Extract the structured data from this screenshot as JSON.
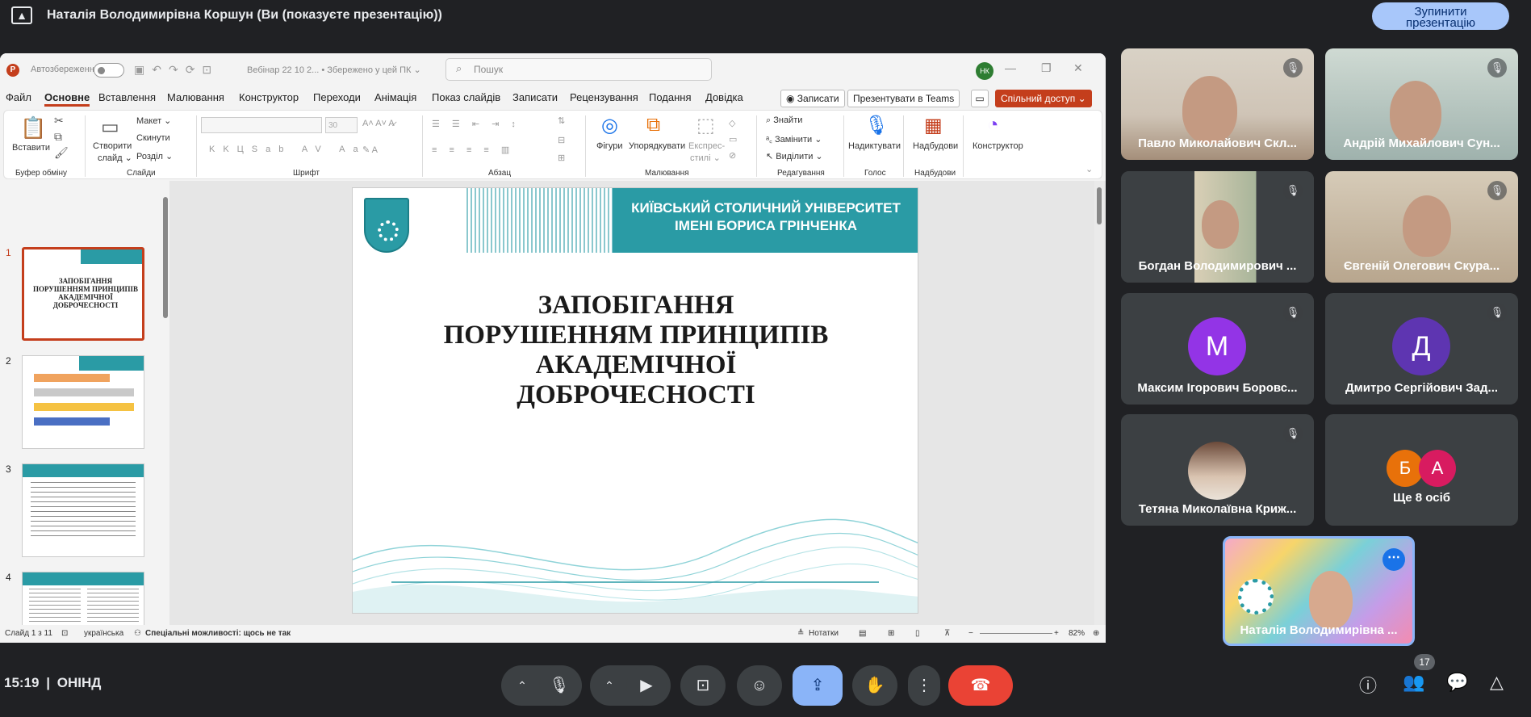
{
  "top": {
    "title": "Наталія Володимирівна Коршун (Ви (показуєте презентацію))",
    "stop_line1": "Зупинити",
    "stop_line2": "презентацію"
  },
  "ppt": {
    "autosave": "Автозбереження",
    "doc_name": "Вебінар 22 10 2...  •  Збережено у цей ПК ⌄",
    "search_placeholder": "Пошук",
    "user_initials": "НК",
    "menu": [
      "Файл",
      "Основне",
      "Вставлення",
      "Малювання",
      "Конструктор",
      "Переходи",
      "Анімація",
      "Показ слайдів",
      "Записати",
      "Рецензування",
      "Подання",
      "Довідка"
    ],
    "record_btn": "◉ Записати",
    "teams_btn": "Презентувати в Teams",
    "share_btn": "Спільний доступ ⌄",
    "ribbon": {
      "paste": "Вставити",
      "clipboard": "Буфер обміну",
      "new_slide_1": "Створити",
      "new_slide_2": "слайд ⌄",
      "layout": "Макет ⌄",
      "reset": "Скинути",
      "section": "Розділ ⌄",
      "slides": "Слайди",
      "font_size": "30",
      "font": "Шрифт",
      "paragraph": "Абзац",
      "shapes": "Фігури",
      "arrange": "Упорядкувати",
      "quick_styles_1": "Експрес-",
      "quick_styles_2": "стилі ⌄",
      "drawing": "Малювання",
      "find": "Знайти",
      "replace": "Замінити ⌄",
      "select": "Виділити ⌄",
      "editing": "Редагування",
      "dictate": "Надиктувати",
      "voice": "Голос",
      "addins_btn": "Надбудови",
      "addins": "Надбудови",
      "designer": "Конструктор"
    },
    "thumb_numbers": [
      "1",
      "2",
      "3",
      "4"
    ],
    "slide": {
      "uni_line1": "КИЇВСЬКИЙ СТОЛИЧНИЙ УНІВЕРСИТЕТ",
      "uni_line2": "ІМЕНІ БОРИСА ГРІНЧЕНКА",
      "title_lines": [
        "ЗАПОБІГАННЯ",
        "ПОРУШЕННЯМ ПРИНЦИПІВ",
        "АКАДЕМІЧНОЇ",
        "ДОБРОЧЕСНОСТІ"
      ]
    },
    "status": {
      "slide_count": "Слайд 1 з 11",
      "language": "українська",
      "accessibility": "Спеціальні можливості: щось не так",
      "notes": "Нотатки",
      "zoom": "82%"
    }
  },
  "participants": [
    "Павло Миколайович Скл...",
    "Андрій Михайлович Сун...",
    "Богдан Володимирович ...",
    "Євгеній Олегович Скура...",
    "Максим Ігорович Боровс...",
    "Дмитро Сергійович Зад...",
    "Тетяна Миколаївна Криж...",
    "Ще 8 осіб"
  ],
  "avatars": {
    "maksym": "М",
    "dmytro": "Д",
    "more1": "Б",
    "more2": "А"
  },
  "self_name": "Наталія Володимирівна ...",
  "bottom": {
    "clock": "15:19",
    "sep": "|",
    "code": "ОНІНД",
    "participants_badge": "17"
  },
  "colors": {
    "accent": "#2a9ba5",
    "ppt_red": "#c43e1c",
    "end_call": "#ea4335",
    "present_active": "#8ab4f8",
    "avatar_m": "#9334e6",
    "avatar_d": "#5e35b1",
    "avatar_b": "#e8710a",
    "avatar_a": "#d81b60"
  }
}
